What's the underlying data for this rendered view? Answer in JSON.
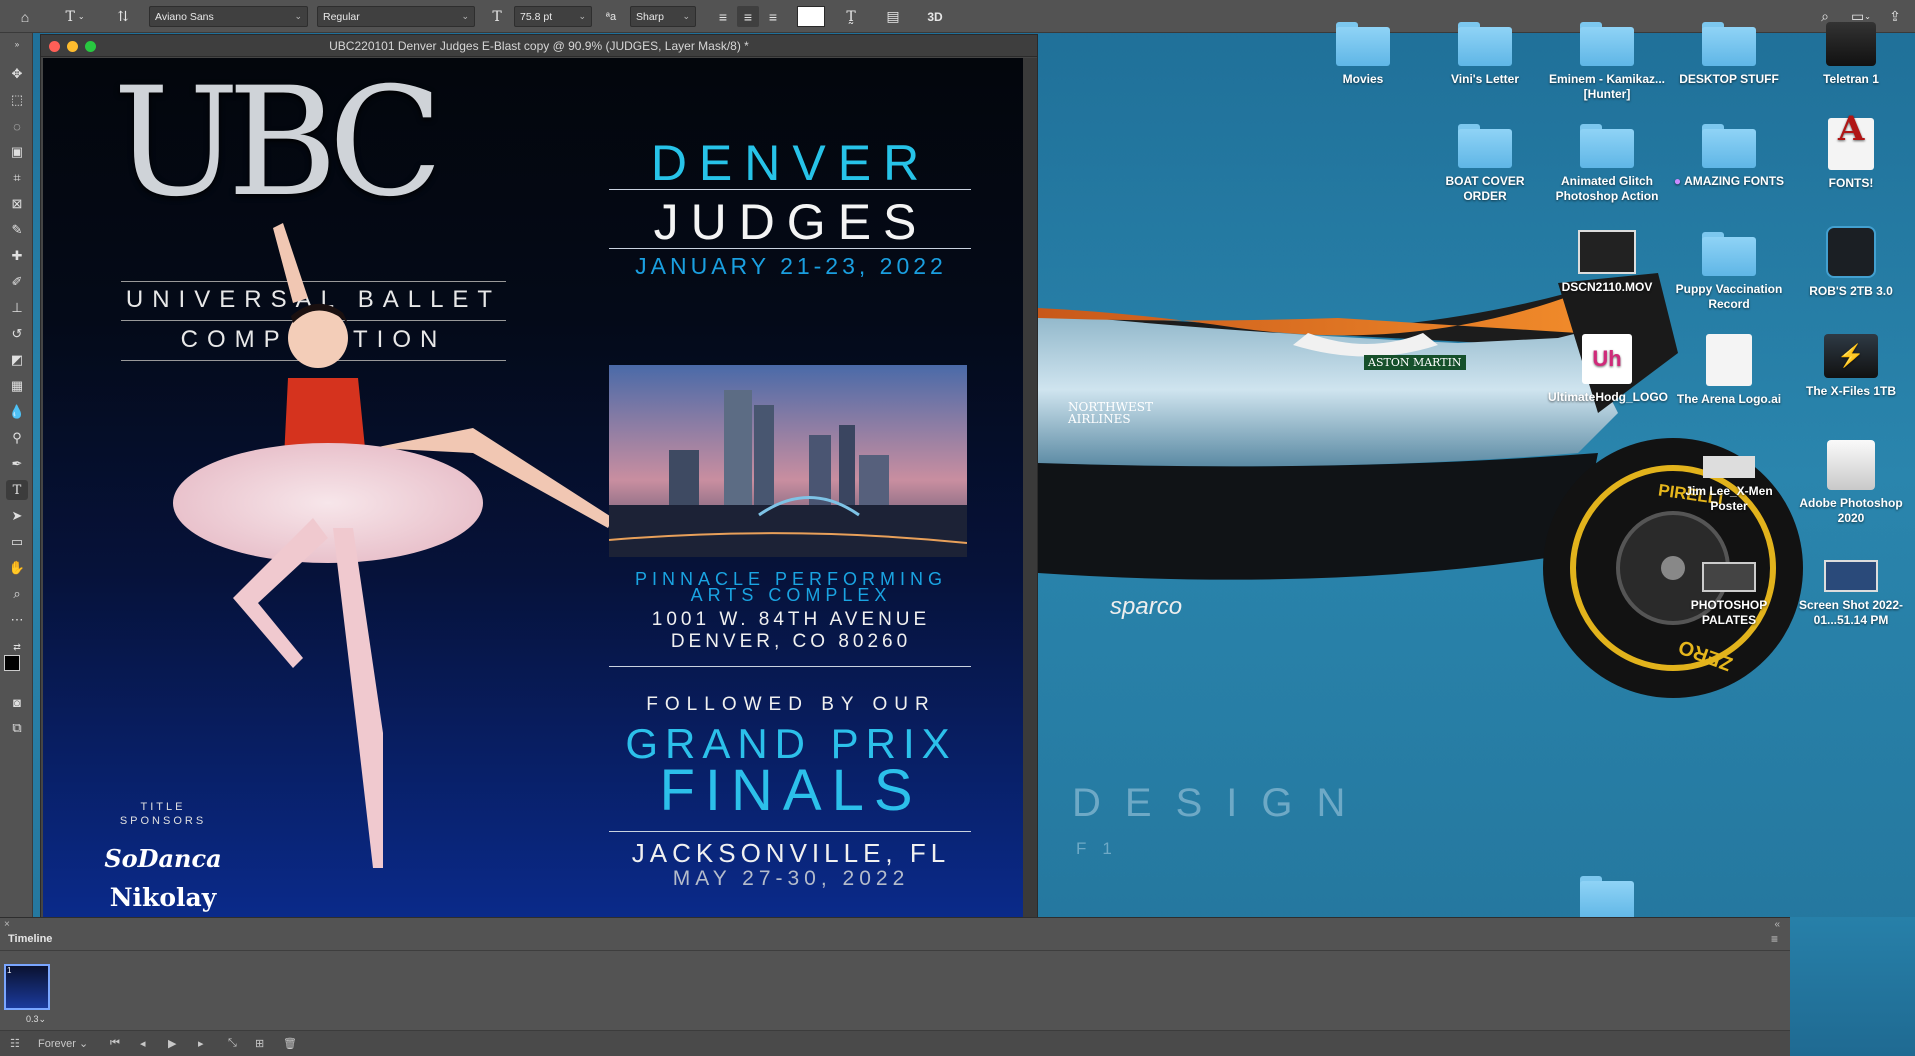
{
  "options_bar": {
    "font_family": "Aviano Sans",
    "font_style": "Regular",
    "font_size": "75.8 pt",
    "antialias": "Sharp",
    "three_d_label": "3D"
  },
  "document": {
    "title": "UBC220101 Denver Judges E-Blast copy @ 90.9% (JUDGES, Layer Mask/8) *",
    "poster": {
      "logo_letters": "UBC",
      "org_line1": "UNIVERSAL BALLET",
      "org_line2": "COMPETITION",
      "headline1": "DENVER",
      "headline2": "JUDGES",
      "dates": "JANUARY 21-23, 2022",
      "venue_line1": "PINNACLE PERFORMING",
      "venue_line2": "ARTS COMPLEX",
      "address1": "1001 W. 84TH AVENUE",
      "address2": "DENVER, CO 80260",
      "followed": "FOLLOWED BY OUR",
      "finals1": "GRAND PRIX",
      "finals2": "FINALS",
      "finals_city": "JACKSONVILLE, FL",
      "finals_dates": "MAY 27-30, 2022",
      "sponsors_label1": "TITLE",
      "sponsors_label2": "SPONSORS",
      "sponsor1": "SoDanca",
      "sponsor2": "Nikolay"
    }
  },
  "desktop": {
    "icons": [
      {
        "label": "Movies",
        "type": "folder"
      },
      {
        "label": "Vini's Letter",
        "type": "folder"
      },
      {
        "label": "Eminem - Kamikaz...[Hunter]",
        "type": "folder"
      },
      {
        "label": "DESKTOP STUFF",
        "type": "folder"
      },
      {
        "label": "Teletran 1",
        "type": "drive"
      },
      {
        "label": "BOAT COVER ORDER",
        "type": "folder"
      },
      {
        "label": "Animated Glitch Photoshop Action",
        "type": "folder"
      },
      {
        "label": "AMAZING FONTS",
        "type": "folder"
      },
      {
        "label": "FONTS!",
        "type": "font-file"
      },
      {
        "label": "DSCN2110.MOV",
        "type": "video"
      },
      {
        "label": "Puppy Vaccination Record",
        "type": "folder"
      },
      {
        "label": "ROB'S 2TB 3.0",
        "type": "drive"
      },
      {
        "label": "UltimateHodg_LOGO",
        "type": "image"
      },
      {
        "label": "The Arena Logo.ai",
        "type": "image"
      },
      {
        "label": "The X-Files 1TB",
        "type": "drive"
      },
      {
        "label": "Jim Lee_X-Men Poster",
        "type": "image"
      },
      {
        "label": "Adobe Photoshop 2020",
        "type": "drive"
      },
      {
        "label": "PHOTOSHOP PALATES",
        "type": "image"
      },
      {
        "label": "Screen Shot 2022-01...51.14 PM",
        "type": "image"
      }
    ],
    "wallpaper_text": {
      "design": "DESIGN",
      "sub": "F1",
      "brand1": "ASTON MARTIN",
      "brand2": "NORTHWEST AIRLINES",
      "brand3": "sparco",
      "tire": "PIRELLI",
      "tire2": "ZERO"
    }
  },
  "timeline": {
    "title": "Timeline",
    "frame_delay": "0.3",
    "loop": "Forever"
  },
  "colors": {
    "accent_cyan": "#27c3e8",
    "wallpaper": "#2a85ad",
    "panel": "#535353",
    "poster_bg": "#06123a"
  }
}
